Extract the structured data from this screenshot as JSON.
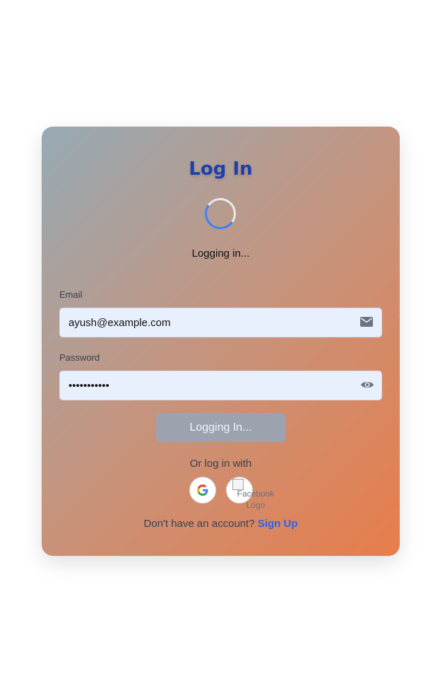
{
  "title": "Log In",
  "loading_text": "Logging in...",
  "email": {
    "label": "Email",
    "value": "ayush@example.com"
  },
  "password": {
    "label": "Password",
    "value": "•••••••••••"
  },
  "submit_label": "Logging In...",
  "social": {
    "prompt": "Or log in with",
    "facebook_alt": "Facebook Logo"
  },
  "signup": {
    "prompt": "Don't have an account?",
    "link": "Sign Up"
  },
  "colors": {
    "title": "#1e40af",
    "link": "#2563eb",
    "button_disabled": "#9ca3af",
    "input_bg": "#e8effd"
  },
  "icons": {
    "email": "envelope-icon",
    "password": "eye-icon",
    "google": "google-logo-icon"
  }
}
